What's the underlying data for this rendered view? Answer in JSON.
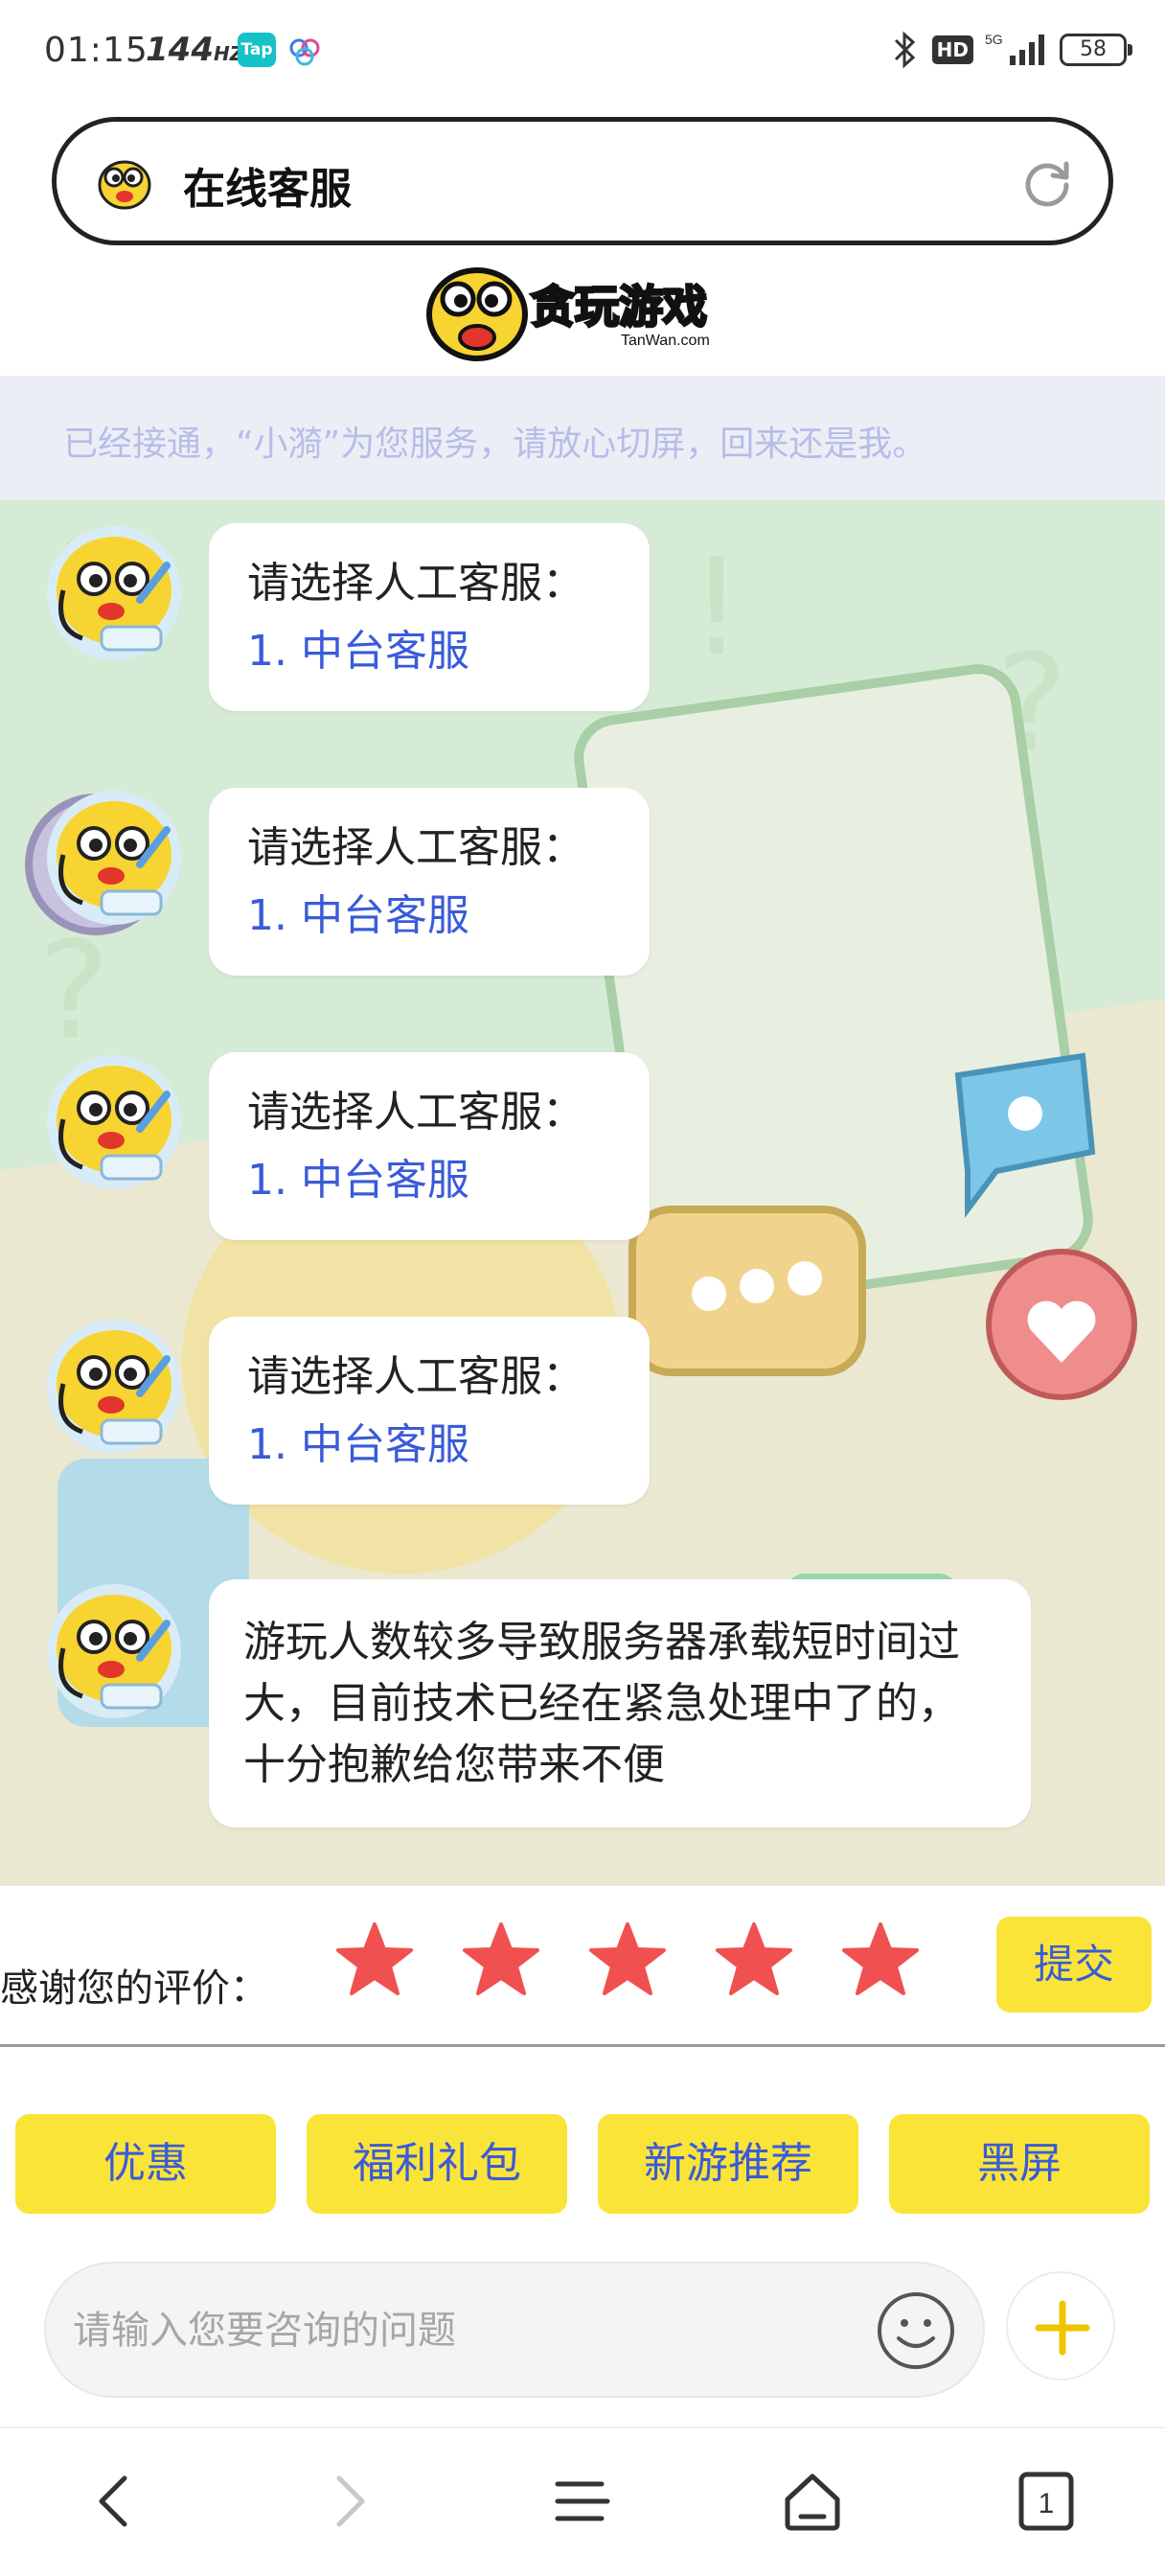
{
  "status_bar": {
    "time": "01:15",
    "refresh_rate": "144",
    "refresh_unit": "HZ",
    "tap_label": "Tap",
    "hd_label": "HD",
    "network": "5G",
    "battery": "58"
  },
  "header": {
    "title": "在线客服",
    "refresh_icon": "refresh-icon"
  },
  "brand": {
    "logo_text": "贪玩游戏",
    "logo_sub": "TanWan.com"
  },
  "notice": {
    "text": "已经接通，“小漪”为您服务，请放心切屏，回来还是我。"
  },
  "messages": [
    {
      "title": "请选择人工客服：",
      "link": "1. 中台客服"
    },
    {
      "title": "请选择人工客服：",
      "link": "1. 中台客服"
    },
    {
      "title": "请选择人工客服：",
      "link": "1. 中台客服"
    },
    {
      "title": "请选择人工客服：",
      "link": "1. 中台客服"
    }
  ],
  "last_message": {
    "text": "游玩人数较多导致服务器承载短时间过大，目前技术已经在紧急处理中了的，十分抱歉给您带来不便"
  },
  "rating": {
    "label": "感谢您的评价：",
    "stars": 5,
    "star_color": "#f0504f",
    "submit_label": "提交"
  },
  "quick_buttons": [
    "优惠",
    "福利礼包",
    "新游推荐",
    "黑屏"
  ],
  "input": {
    "placeholder": "请输入您要咨询的问题",
    "value": ""
  },
  "colors": {
    "accent_yellow": "#fae438",
    "link_blue": "#3a5bd8",
    "chat_bg": "#d9ecd9"
  },
  "bottom_nav": {
    "tab_count": "1",
    "icons": [
      "back-icon",
      "forward-icon",
      "menu-icon",
      "home-icon",
      "tabs-icon"
    ]
  }
}
